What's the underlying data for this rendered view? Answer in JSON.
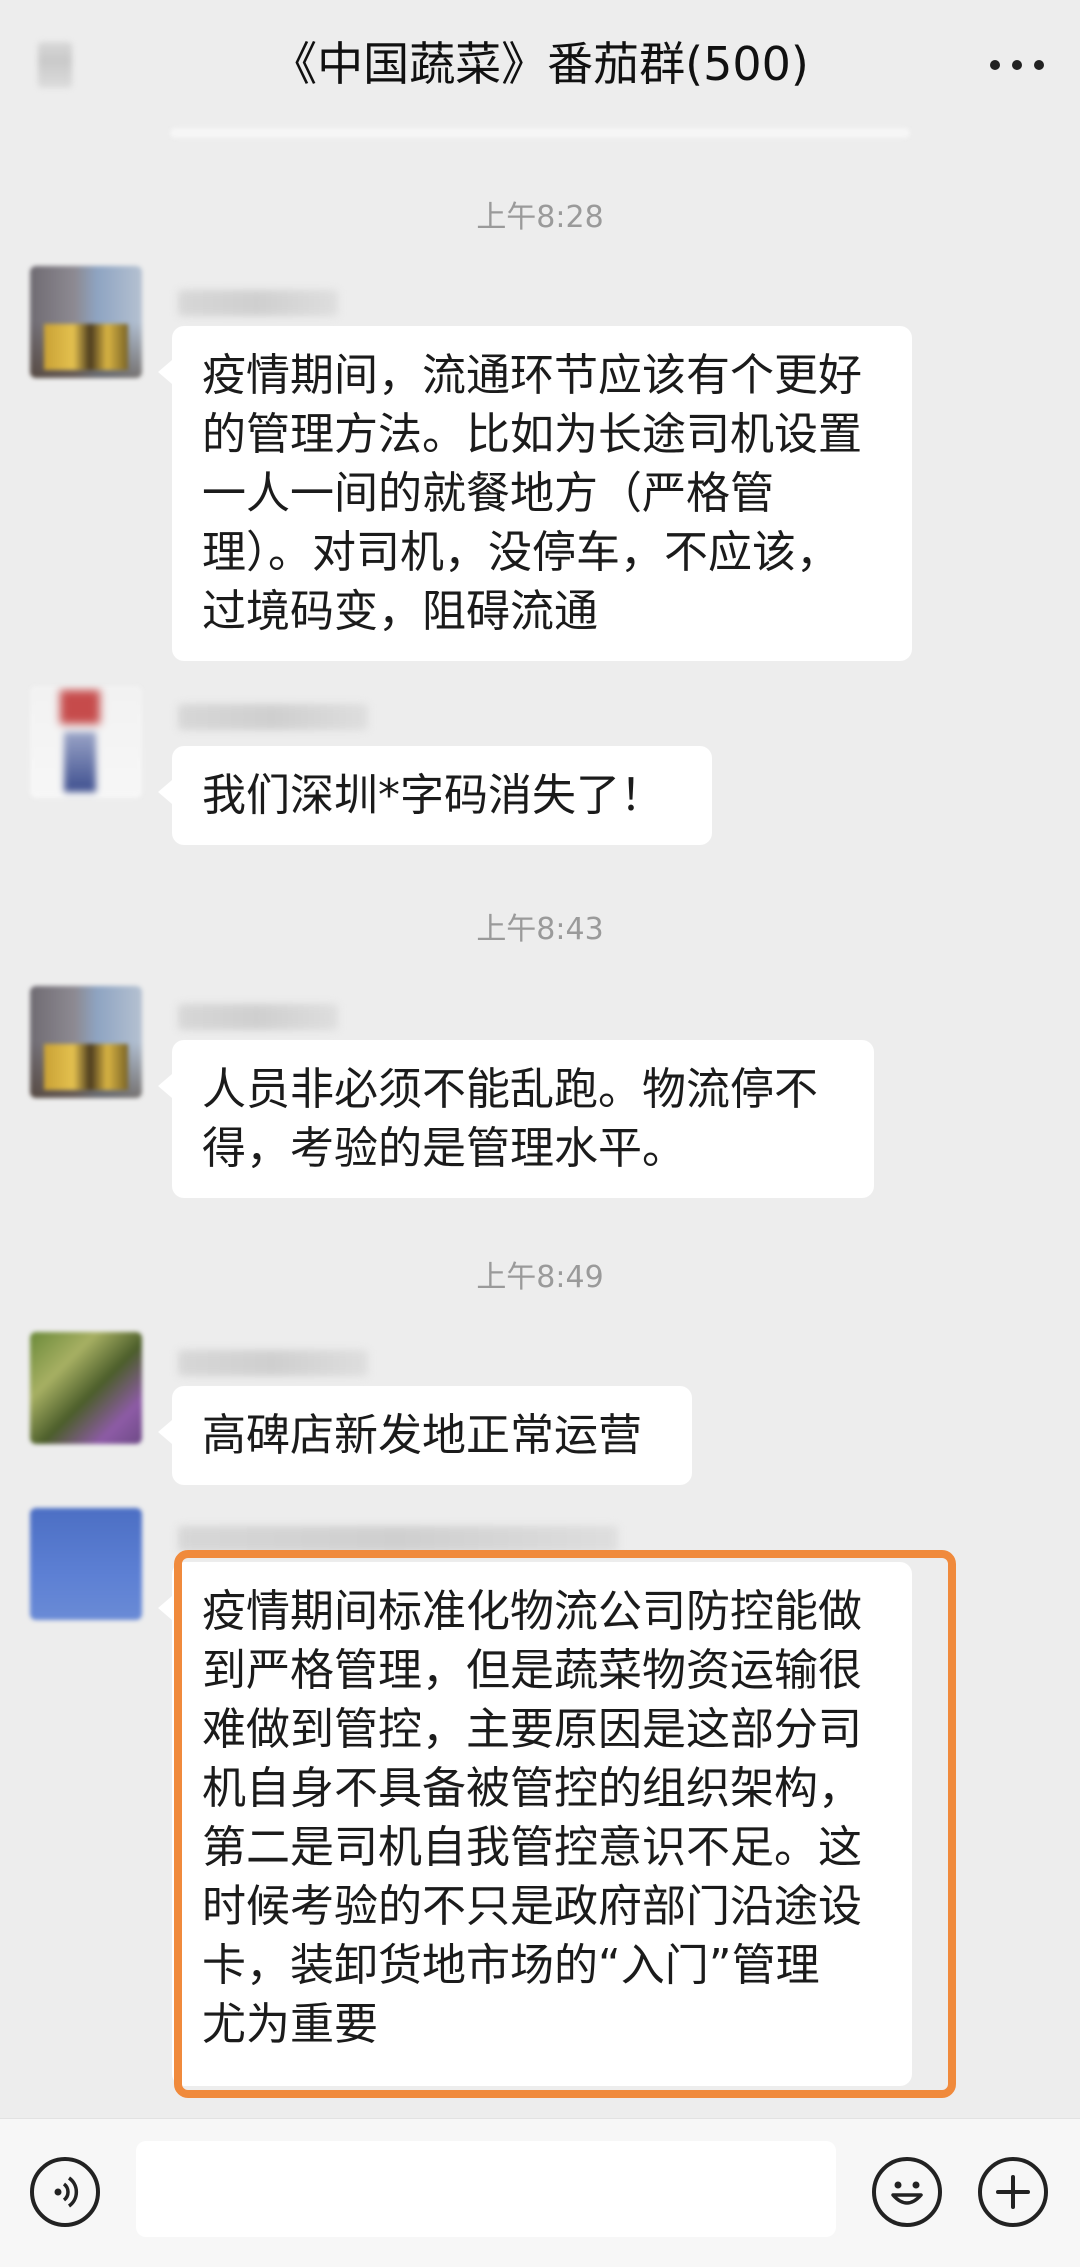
{
  "header": {
    "title": "《中国蔬菜》番茄群(500)"
  },
  "times": [
    "上午8:28",
    "上午8:43",
    "上午8:49"
  ],
  "messages": [
    {
      "text": "疫情期间，流通环节应该有个更好\n的管理方法。比如为长途司机设置\n一人一间的就餐地方（严格管\n理）。对司机，没停车，不应该，\n过境码变，阻碍流通"
    },
    {
      "text": "我们深圳*字码消失了！"
    },
    {
      "text": "人员非必须不能乱跑。物流停不\n得，考验的是管理水平。"
    },
    {
      "text": "高碑店新发地正常运营"
    },
    {
      "text": "疫情期间标准化物流公司防控能做\n到严格管理，但是蔬菜物资运输很\n难做到管控，主要原因是这部分司\n机自身不具备被管控的组织架构，\n第二是司机自我管控意识不足。这\n时候考验的不只是政府部门沿途设\n卡，装卸货地市场的“入门”管理\n尤为重要"
    }
  ],
  "icons": {
    "back": "back-icon",
    "more": "more-icon",
    "voice": "voice-icon",
    "emoji": "emoji-icon",
    "add": "plus-icon"
  },
  "colors": {
    "highlight": "#f08a3c",
    "background": "#ededed",
    "bubble": "#ffffff"
  }
}
